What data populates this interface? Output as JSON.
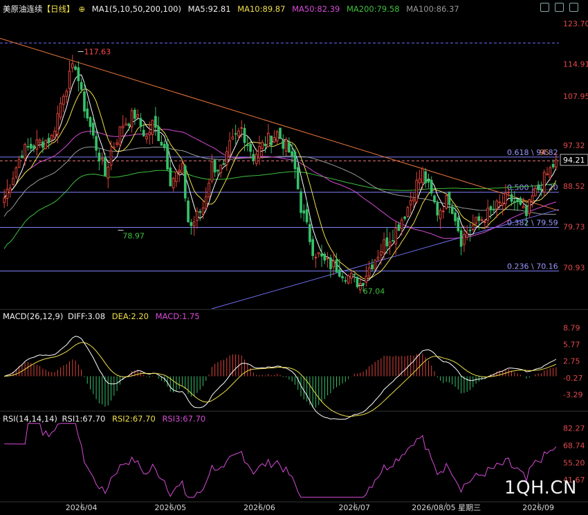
{
  "header": {
    "symbol": "美原油连续",
    "period": "【日线】",
    "ma_group": "MA1(5,10,50,200,100)",
    "ma5": "MA5:92.81",
    "ma10": "MA10:89.87",
    "ma50": "MA50:82.39",
    "ma200": "MA200:79.58",
    "ma100": "MA100:86.37"
  },
  "macd_header": {
    "label": "MACD(26,12,9)",
    "diff": "DIFF:3.08",
    "dea": "DEA:2.20",
    "macd": "MACD:1.75"
  },
  "rsi_header": {
    "label": "RSI(14,14,14)",
    "rsi1": "RSI1:67.70",
    "rsi2": "RSI2:67.70",
    "rsi3": "RSI3:67.70"
  },
  "watermark": "1QH.CN",
  "colors": {
    "background": "#000000",
    "up": "#e0443a",
    "down": "#37c06a",
    "ma5": "#ffffff",
    "ma10": "#f0e04a",
    "ma50": "#d84cd8",
    "ma200": "#3ec23e",
    "ma100": "#9a9a9a",
    "trendline_down": "#f07a3a",
    "trendline_up": "#6f6ff0",
    "fib": "#8080ff",
    "rsi": "#d84cd8",
    "diff": "#ffffff",
    "dea": "#f0e04a"
  },
  "chart_data": [
    {
      "type": "candlestick",
      "panel": "price",
      "yticks": [
        123.7,
        114.91,
        107.95,
        97.32,
        88.52,
        79.73,
        70.93
      ],
      "ylim": [
        62.0,
        125.5
      ],
      "xticks": [
        "2026/04",
        "2026/05",
        "2026/06",
        "2026/07",
        "2026/08/05 星期三",
        "2026/09"
      ],
      "last_price": "94.21",
      "annotations": [
        {
          "text": "117.63",
          "kind": "high"
        },
        {
          "text": "78.97",
          "kind": "low"
        },
        {
          "text": "67.04",
          "kind": "low"
        }
      ],
      "fib_levels": [
        {
          "ratio": "0.618",
          "value": 94.82,
          "label": "0.618 \\ 94.82"
        },
        {
          "ratio": "0.500",
          "value": 87.2,
          "label": "0.500 \\ 87.20"
        },
        {
          "ratio": "0.382",
          "value": 79.59,
          "label": "0.382 \\ 79.59"
        },
        {
          "ratio": "0.236",
          "value": 70.16,
          "label": "0.236 \\ 70.16"
        }
      ],
      "fib_extra_label": "95",
      "dashed_levels": [
        119.5,
        94.0
      ],
      "trend_keypoints": [
        [
          0,
          86
        ],
        [
          6,
          96
        ],
        [
          12,
          98
        ],
        [
          16,
          99
        ],
        [
          20,
          109
        ],
        [
          24,
          115
        ],
        [
          26,
          108
        ],
        [
          30,
          99
        ],
        [
          34,
          91
        ],
        [
          36,
          96
        ],
        [
          40,
          102
        ],
        [
          44,
          104
        ],
        [
          48,
          99
        ],
        [
          50,
          102
        ],
        [
          54,
          97
        ],
        [
          56,
          90
        ],
        [
          60,
          92
        ],
        [
          62,
          81
        ],
        [
          63,
          80
        ],
        [
          67,
          84
        ],
        [
          70,
          93
        ],
        [
          74,
          92
        ],
        [
          76,
          97
        ],
        [
          80,
          101
        ],
        [
          84,
          95
        ],
        [
          88,
          98
        ],
        [
          92,
          100
        ],
        [
          96,
          96
        ],
        [
          98,
          92
        ],
        [
          100,
          84
        ],
        [
          104,
          75
        ],
        [
          108,
          72
        ],
        [
          112,
          71
        ],
        [
          116,
          69
        ],
        [
          120,
          67.5
        ],
        [
          124,
          72
        ],
        [
          128,
          76
        ],
        [
          132,
          79
        ],
        [
          136,
          84
        ],
        [
          139,
          89
        ],
        [
          141,
          91.5
        ],
        [
          143,
          88
        ],
        [
          146,
          83
        ],
        [
          150,
          86
        ],
        [
          152,
          82
        ],
        [
          154,
          77
        ],
        [
          158,
          80
        ],
        [
          162,
          82
        ],
        [
          166,
          84
        ],
        [
          170,
          86
        ],
        [
          173,
          84.5
        ],
        [
          176,
          82
        ],
        [
          178,
          86
        ],
        [
          182,
          90
        ],
        [
          186,
          94
        ]
      ],
      "moving_average_levels": {
        "ma5": 92.81,
        "ma10": 89.87,
        "ma50": 82.39,
        "ma100": 86.37,
        "ma200": 79.58
      }
    },
    {
      "type": "bar",
      "panel": "macd",
      "yticks": [
        8.79,
        5.77,
        2.75,
        -0.27,
        -3.29
      ],
      "ylim": [
        -5.8,
        10.2
      ],
      "last": {
        "diff": 3.08,
        "dea": 2.2,
        "macd": 1.75
      }
    },
    {
      "type": "line",
      "panel": "rsi",
      "yticks": [
        82.27,
        68.74,
        55.2,
        41.67
      ],
      "ylim": [
        26.0,
        88.0
      ],
      "last": {
        "rsi1": 67.7,
        "rsi2": 67.7,
        "rsi3": 67.7
      }
    }
  ]
}
